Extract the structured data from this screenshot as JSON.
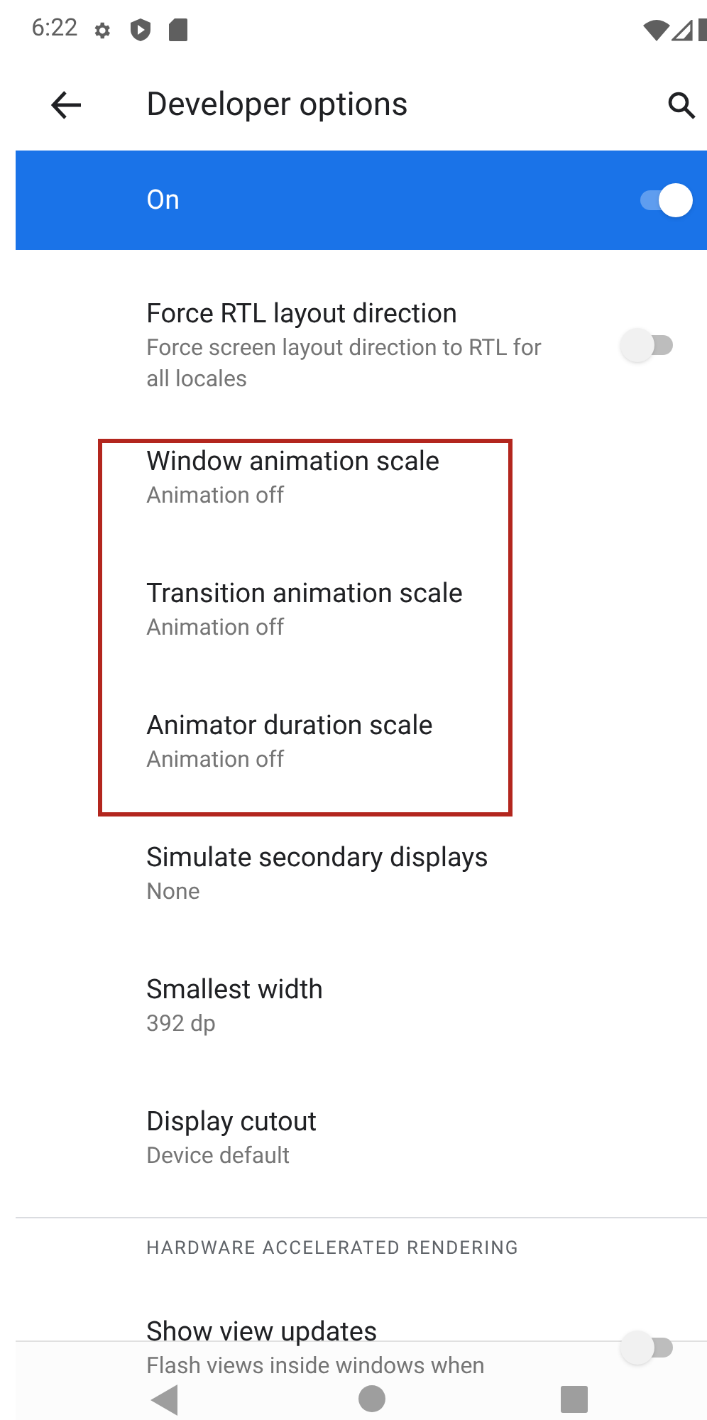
{
  "status_bar": {
    "time": "6:22"
  },
  "toolbar": {
    "title": "Developer options"
  },
  "master_switch": {
    "label": "On",
    "on": true
  },
  "items": [
    {
      "kind": "switch",
      "title": "Force RTL layout direction",
      "summary": "Force screen layout direction to RTL for all locales",
      "on": false
    },
    {
      "kind": "highlight",
      "children": [
        {
          "kind": "plain",
          "title": "Window animation scale",
          "summary": "Animation off"
        },
        {
          "kind": "plain",
          "title": "Transition animation scale",
          "summary": "Animation off"
        },
        {
          "kind": "plain",
          "title": "Animator duration scale",
          "summary": "Animation off"
        }
      ]
    },
    {
      "kind": "plain",
      "title": "Simulate secondary displays",
      "summary": "None"
    },
    {
      "kind": "plain",
      "title": "Smallest width",
      "summary": "392 dp"
    },
    {
      "kind": "plain",
      "title": "Display cutout",
      "summary": "Device default"
    },
    {
      "kind": "divider"
    },
    {
      "kind": "header",
      "title": "HARDWARE ACCELERATED RENDERING"
    },
    {
      "kind": "switch",
      "title": "Show view updates",
      "summary": "Flash views inside windows when",
      "on": false
    }
  ]
}
